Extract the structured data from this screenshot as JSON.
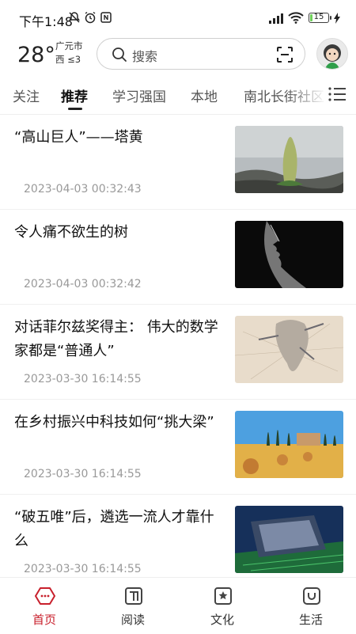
{
  "status_bar": {
    "time": "下午1:48",
    "battery_level": "15"
  },
  "header": {
    "temperature": "28°",
    "city": "广元市",
    "wind": "西 ≤3",
    "search_placeholder": "搜索"
  },
  "tabs": [
    {
      "label": "关注",
      "active": false
    },
    {
      "label": "推荐",
      "active": true
    },
    {
      "label": "学习强国",
      "active": false
    },
    {
      "label": "本地",
      "active": false
    },
    {
      "label": "南北长街社区",
      "active": false
    }
  ],
  "feed": [
    {
      "title": "“高山巨人”——塔黄",
      "time": "2023-04-03 00:32:43",
      "thumb_icon": "plant-thumbnail"
    },
    {
      "title": "令人痛不欲生的树",
      "time": "2023-04-03 00:32:42",
      "thumb_icon": "face-profile-thumbnail"
    },
    {
      "title": "对话菲尔兹奖得主： 伟大的数学家都是“普通人”",
      "time": "2023-03-30 16:14:55",
      "thumb_icon": "shell-drawing-thumbnail"
    },
    {
      "title": "在乡村振兴中科技如何“挑大梁”",
      "time": "2023-03-30 16:14:55",
      "thumb_icon": "countryside-thumbnail"
    },
    {
      "title": "“破五唯”后，遴选一流人才靠什么",
      "time": "2023-03-30 16:14:55",
      "thumb_icon": "chip-thumbnail"
    }
  ],
  "bottom_nav": [
    {
      "label": "首页",
      "icon": "home-icon",
      "active": true
    },
    {
      "label": "阅读",
      "icon": "book-icon",
      "active": false
    },
    {
      "label": "文化",
      "icon": "culture-icon",
      "active": false
    },
    {
      "label": "生活",
      "icon": "life-icon",
      "active": false
    }
  ],
  "colors": {
    "accent": "#c8202c",
    "battery": "#6fcf5a"
  }
}
